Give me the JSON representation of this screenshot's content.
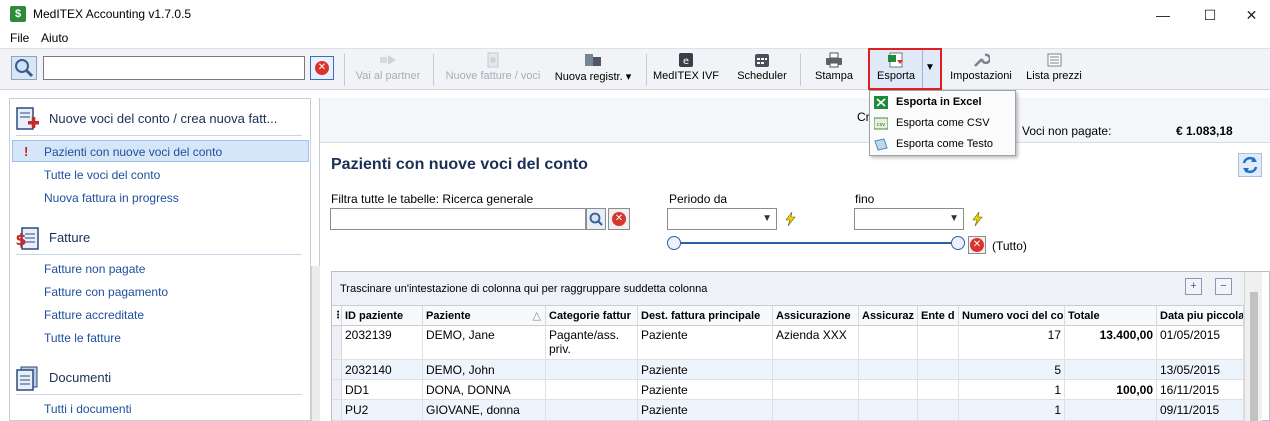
{
  "window": {
    "title": "MedITEX Accounting v1.7.0.5",
    "minimize_glyph": "—",
    "maximize_glyph": "☐",
    "close_glyph": "✕"
  },
  "menu": [
    "File",
    "Aiuto"
  ],
  "search": {
    "value": "",
    "placeholder": ""
  },
  "toolbar": {
    "vai_al_partner": "Vai al partner",
    "nuove_fatture": "Nuove fatture / voci",
    "nuova_registr": "Nuova registr.",
    "meditex_ivf": "MedITEX IVF",
    "scheduler": "Scheduler",
    "stampa": "Stampa",
    "esporta": "Esporta",
    "impostazioni": "Impostazioni",
    "lista_prezzi": "Lista prezzi"
  },
  "export_menu": [
    "Esporta in Excel",
    "Esporta come CSV",
    "Esporta come Testo"
  ],
  "sidebar": {
    "section_new": "Nuove voci del conto / crea nuova fatt...",
    "items_new": [
      "Pazienti con nuove voci del conto",
      "Tutte le voci del conto",
      "Nuova fattura in progress"
    ],
    "section_fatture": "Fatture",
    "items_fatture": [
      "Fatture non pagate",
      "Fatture con pagamento",
      "Fatture accreditate",
      "Tutte le fatture"
    ],
    "section_documenti": "Documenti",
    "items_documenti": [
      "Tutti i documenti"
    ],
    "alert_glyph": "!"
  },
  "summary": {
    "partial_label": "Cr",
    "unpaid_label": "Voci non pagate:",
    "unpaid_value": "€ 1.083,18"
  },
  "main": {
    "title": "Pazienti con nuove voci del conto",
    "filter_label": "Filtra tutte le tabelle:",
    "filter_mode": "Ricerca generale",
    "period_from": "Periodo da",
    "period_to": "fino",
    "range_label": "(Tutto)"
  },
  "grid": {
    "group_hint": "Trascinare un'intestazione di colonna qui per raggruppare suddetta colonna",
    "expand_glyph": "+",
    "collapse_glyph": "−",
    "columns": [
      "ID paziente",
      "Paziente",
      "Categorie fattur",
      "Dest. fattura principale",
      "Assicurazione",
      "Assicuraz",
      "Ente d",
      "Numero voci del co",
      "Totale",
      "Data piu piccola"
    ],
    "rows": [
      [
        "2032139",
        "DEMO, Jane",
        "Pagante/ass. priv.",
        "Paziente",
        "Azienda XXX",
        "",
        "",
        "17",
        "13.400,00",
        "01/05/2015"
      ],
      [
        "2032140",
        "DEMO, John",
        "",
        "Paziente",
        "",
        "",
        "",
        "5",
        "",
        "13/05/2015"
      ],
      [
        "DD1",
        "DONA, DONNA",
        "",
        "Paziente",
        "",
        "",
        "",
        "1",
        "100,00",
        "16/11/2015"
      ],
      [
        "PU2",
        "GIOVANE, donna",
        "",
        "Paziente",
        "",
        "",
        "",
        "1",
        "",
        "09/11/2015"
      ]
    ]
  },
  "colors": {
    "accent": "#1b2f57",
    "link": "#1e4f9c",
    "highlight": "#d4e6f8",
    "red": "#e02020"
  }
}
